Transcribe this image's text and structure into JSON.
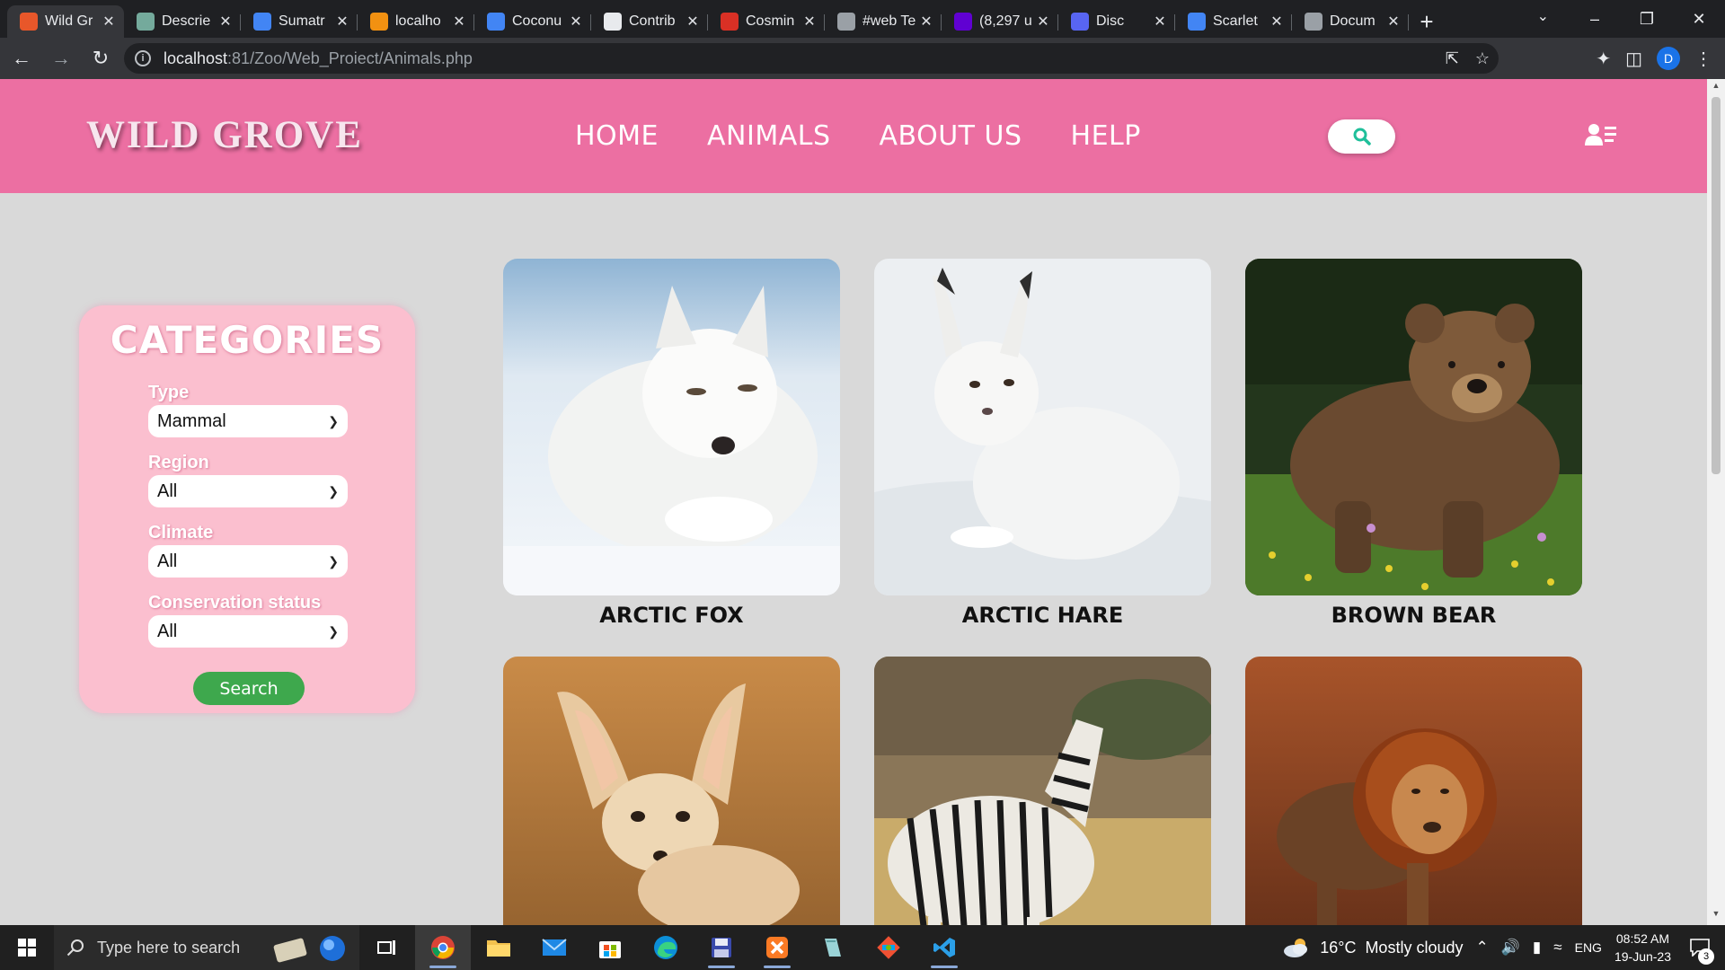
{
  "browser": {
    "tabs": [
      {
        "title": "Wild Gr",
        "fav_color": "#e8572a",
        "active": true
      },
      {
        "title": "Descrie",
        "fav_color": "#74aa9c",
        "active": false
      },
      {
        "title": "Sumatr",
        "fav_color": "#4285f4",
        "active": false
      },
      {
        "title": "localho",
        "fav_color": "#f29111",
        "active": false
      },
      {
        "title": "Coconu",
        "fav_color": "#4285f4",
        "active": false
      },
      {
        "title": "Contrib",
        "fav_color": "#e8eaed",
        "active": false
      },
      {
        "title": "Cosmin",
        "fav_color": "#d93025",
        "active": false
      },
      {
        "title": "#web Te",
        "fav_color": "#9aa0a6",
        "active": false
      },
      {
        "title": "(8,297 u",
        "fav_color": "#6001d2",
        "active": false
      },
      {
        "title": "Disc",
        "fav_color": "#5865f2",
        "active": false
      },
      {
        "title": "Scarlet",
        "fav_color": "#4285f4",
        "active": false
      },
      {
        "title": "Docum",
        "fav_color": "#9aa0a6",
        "active": false
      }
    ],
    "url_host": "localhost",
    "url_rest": ":81/Zoo/Web_Proiect/Animals.php",
    "profile_initial": "D"
  },
  "site": {
    "logo": "WILD GROVE",
    "nav": [
      "HOME",
      "ANIMALS",
      "ABOUT US",
      "HELP"
    ]
  },
  "categories": {
    "title": "CATEGORIES",
    "filters": [
      {
        "label": "Type",
        "value": "Mammal"
      },
      {
        "label": "Region",
        "value": "All"
      },
      {
        "label": "Climate",
        "value": "All"
      },
      {
        "label": "Conservation status",
        "value": "All"
      }
    ],
    "search_label": "Search"
  },
  "animals": [
    {
      "name": "ARCTIC FOX"
    },
    {
      "name": "ARCTIC HARE"
    },
    {
      "name": "BROWN BEAR"
    },
    {
      "name": ""
    },
    {
      "name": ""
    },
    {
      "name": ""
    }
  ],
  "taskbar": {
    "search_placeholder": "Type here to search",
    "weather_temp": "16°C",
    "weather_desc": "Mostly cloudy",
    "language": "ENG",
    "time": "08:52 AM",
    "date": "19-Jun-23",
    "notifications": "3"
  }
}
